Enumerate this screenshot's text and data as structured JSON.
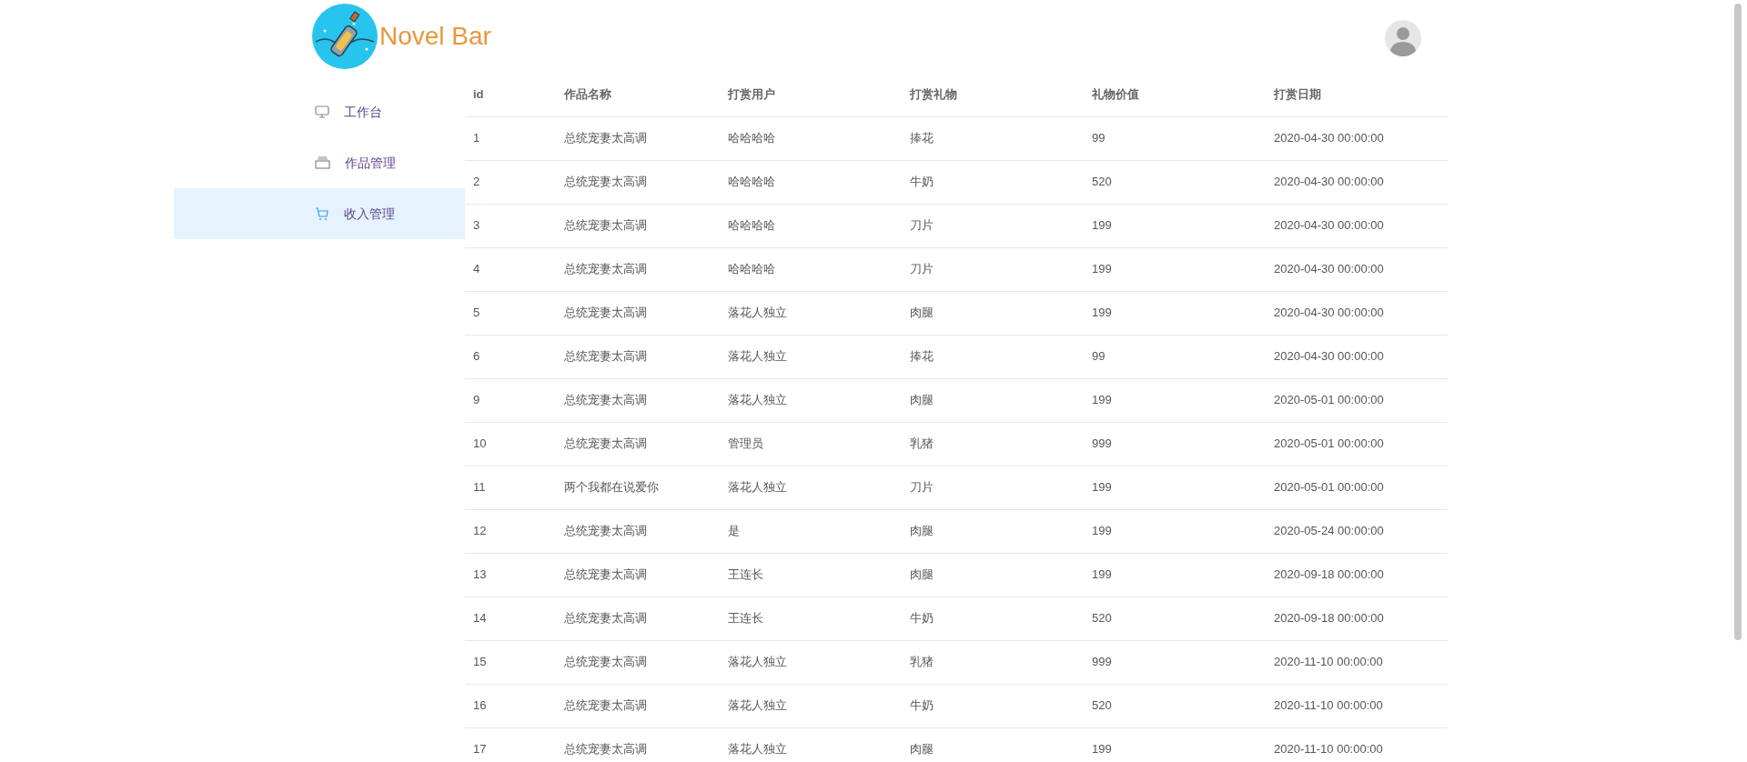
{
  "header": {
    "brand": "Novel Bar"
  },
  "sidebar": {
    "items": [
      {
        "label": "工作台",
        "kind": "monitor",
        "selected": false
      },
      {
        "label": "作品管理",
        "kind": "box",
        "selected": false
      },
      {
        "label": "收入管理",
        "kind": "cart",
        "selected": true
      }
    ]
  },
  "table": {
    "columns": [
      "id",
      "作品名称",
      "打赏用户",
      "打赏礼物",
      "礼物价值",
      "打赏日期"
    ],
    "rows": [
      [
        "1",
        "总统宠妻太高调",
        "哈哈哈哈",
        "捧花",
        "99",
        "2020-04-30 00:00:00"
      ],
      [
        "2",
        "总统宠妻太高调",
        "哈哈哈哈",
        "牛奶",
        "520",
        "2020-04-30 00:00:00"
      ],
      [
        "3",
        "总统宠妻太高调",
        "哈哈哈哈",
        "刀片",
        "199",
        "2020-04-30 00:00:00"
      ],
      [
        "4",
        "总统宠妻太高调",
        "哈哈哈哈",
        "刀片",
        "199",
        "2020-04-30 00:00:00"
      ],
      [
        "5",
        "总统宠妻太高调",
        "落花人独立",
        "肉腿",
        "199",
        "2020-04-30 00:00:00"
      ],
      [
        "6",
        "总统宠妻太高调",
        "落花人独立",
        "捧花",
        "99",
        "2020-04-30 00:00:00"
      ],
      [
        "9",
        "总统宠妻太高调",
        "落花人独立",
        "肉腿",
        "199",
        "2020-05-01 00:00:00"
      ],
      [
        "10",
        "总统宠妻太高调",
        "管理员",
        "乳猪",
        "999",
        "2020-05-01 00:00:00"
      ],
      [
        "11",
        "两个我都在说爱你",
        "落花人独立",
        "刀片",
        "199",
        "2020-05-01 00:00:00"
      ],
      [
        "12",
        "总统宠妻太高调",
        "是",
        "肉腿",
        "199",
        "2020-05-24 00:00:00"
      ],
      [
        "13",
        "总统宠妻太高调",
        "王连长",
        "肉腿",
        "199",
        "2020-09-18 00:00:00"
      ],
      [
        "14",
        "总统宠妻太高调",
        "王连长",
        "牛奶",
        "520",
        "2020-09-18 00:00:00"
      ],
      [
        "15",
        "总统宠妻太高调",
        "落花人独立",
        "乳猪",
        "999",
        "2020-11-10 00:00:00"
      ],
      [
        "16",
        "总统宠妻太高调",
        "落花人独立",
        "牛奶",
        "520",
        "2020-11-10 00:00:00"
      ],
      [
        "17",
        "总统宠妻太高调",
        "落花人独立",
        "肉腿",
        "199",
        "2020-11-10 00:00:00"
      ]
    ]
  }
}
